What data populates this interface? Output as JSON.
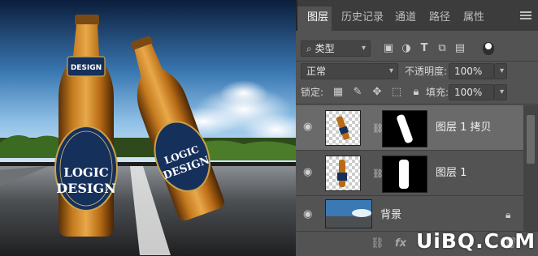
{
  "tabs": [
    "图层",
    "历史记录",
    "通道",
    "路径",
    "属性"
  ],
  "filter": {
    "kind_label": "类型"
  },
  "blend": {
    "mode": "正常",
    "opacity_label": "不透明度:",
    "opacity_value": "100%"
  },
  "lock_row": {
    "lock_label": "锁定:",
    "fill_label": "填充:",
    "fill_value": "100%"
  },
  "layers": [
    {
      "name": "图层 1 拷贝",
      "selected": true
    },
    {
      "name": "图层 1",
      "selected": false
    },
    {
      "name": "背景",
      "selected": false
    }
  ],
  "labels": {
    "bottle_top": "DESIGN",
    "bottle_logic": "LOGIC",
    "bottle_design": "DESIGN"
  },
  "watermark": "UiBQ.CoM",
  "bottombar": {
    "link_icon": "link-icon",
    "fx_label": "fx"
  }
}
